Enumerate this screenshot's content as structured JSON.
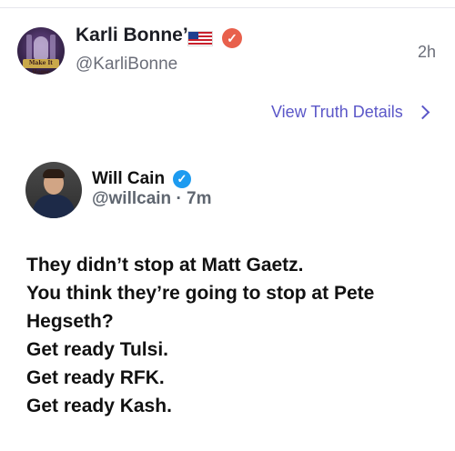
{
  "post": {
    "author_name": "Karli Bonne’",
    "author_handle": "@KarliBonne",
    "timestamp": "2h",
    "flag_icon": "us-flag-icon",
    "badge_icon": "verified-check-icon",
    "badge_color": "#e8604c",
    "avatar_banner": "Make It Home"
  },
  "details_link": {
    "label": "View Truth Details"
  },
  "quoted": {
    "name": "Will Cain",
    "handle_line": "@willcain · 7m",
    "badge_color": "#1d9bf0",
    "lines": [
      "They didn’t stop at Matt Gaetz.",
      "You think they’re going to stop at Pete",
      "Hegseth?",
      "Get ready Tulsi.",
      "Get ready RFK.",
      "Get ready Kash."
    ]
  },
  "colors": {
    "link": "#5b57c8",
    "muted": "#6b6e79"
  }
}
